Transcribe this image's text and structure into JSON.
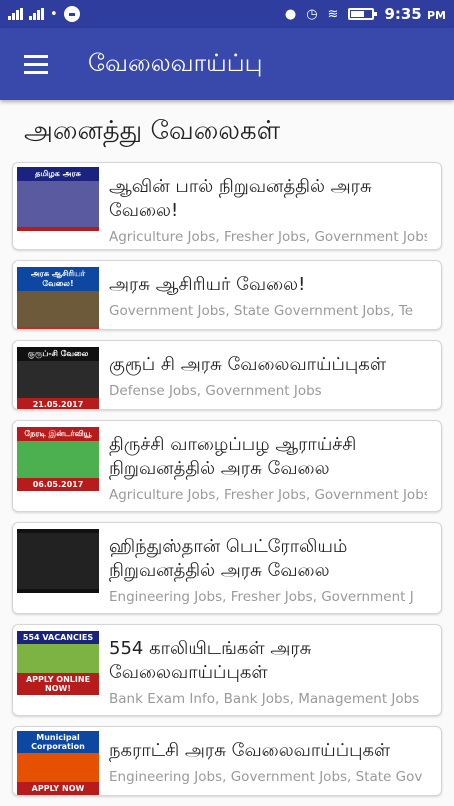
{
  "status_bar": {
    "time": "9:35",
    "meridiem": "PM",
    "battery_level": 0.55
  },
  "app_bar": {
    "title": "வேலைவாய்ப்பு"
  },
  "section": {
    "title": "அனைத்து வேலைகள்"
  },
  "jobs": [
    {
      "title_lines": [
        "ஆவின் பால் நிறுவனத்தில் அரசு",
        "வேலை!"
      ],
      "tags": "Agriculture Jobs, Fresher Jobs, Government Jobs",
      "thumb": {
        "top_band": "தமிழக அரசு",
        "top_color": "#1a237e",
        "art_color": "#5a5aa0",
        "bottom_band": "",
        "bottom_color": "#b71c1c"
      }
    },
    {
      "title_lines": [
        "அரசு ஆசிரியர் வேலை!"
      ],
      "tags": "Government Jobs, State Government Jobs, Te",
      "thumb": {
        "top_band": "அரசு ஆசிரியர் வேலை!",
        "top_color": "#0d47a1",
        "art_color": "#6d5a3a",
        "bottom_band": "",
        "bottom_color": "#c62828"
      }
    },
    {
      "title_lines": [
        "குரூப் சி அரசு வேலைவாய்ப்புகள்"
      ],
      "tags": "Defense Jobs, Government Jobs",
      "thumb": {
        "top_band": "குரூப்-சி வேலை",
        "top_color": "#111111",
        "art_color": "#2b2b2b",
        "bottom_band": "21.05.2017",
        "bottom_color": "#b71c1c"
      }
    },
    {
      "title_lines": [
        "திருச்சி வாழைப்பழ ஆராய்ச்சி",
        "நிறுவனத்தில் அரசு வேலை"
      ],
      "tags": "Agriculture Jobs, Fresher Jobs, Government Jobs",
      "thumb": {
        "top_band": "நேரடி இன்டர்வியூ",
        "top_color": "#b71c1c",
        "art_color": "#4caf50",
        "bottom_band": "06.05.2017",
        "bottom_color": "#b71c1c"
      }
    },
    {
      "title_lines": [
        "ஹிந்துஸ்தான் பெட்ரோலியம்",
        "நிறுவனத்தில் அரசு வேலை"
      ],
      "tags": "Engineering Jobs, Fresher Jobs, Government J",
      "thumb": {
        "top_band": "",
        "top_color": "#111111",
        "art_color": "#222222",
        "bottom_band": "",
        "bottom_color": "#111111"
      }
    },
    {
      "title_lines": [
        "554 காலியிடங்கள் அரசு",
        "வேலைவாய்ப்புகள்"
      ],
      "tags": "Bank Exam Info, Bank Jobs, Management Jobs",
      "thumb": {
        "top_band": "554 VACANCIES",
        "top_color": "#1a237e",
        "art_color": "#7cb342",
        "bottom_band": "APPLY ONLINE NOW!",
        "bottom_color": "#b71c1c"
      }
    },
    {
      "title_lines": [
        "நகராட்சி அரசு வேலைவாய்ப்புகள்"
      ],
      "tags": "Engineering Jobs, Government Jobs, State Gov",
      "thumb": {
        "top_band": "Municipal Corporation",
        "top_color": "#0d47a1",
        "art_color": "#e65100",
        "bottom_band": "APPLY NOW",
        "bottom_color": "#b71c1c"
      }
    }
  ]
}
